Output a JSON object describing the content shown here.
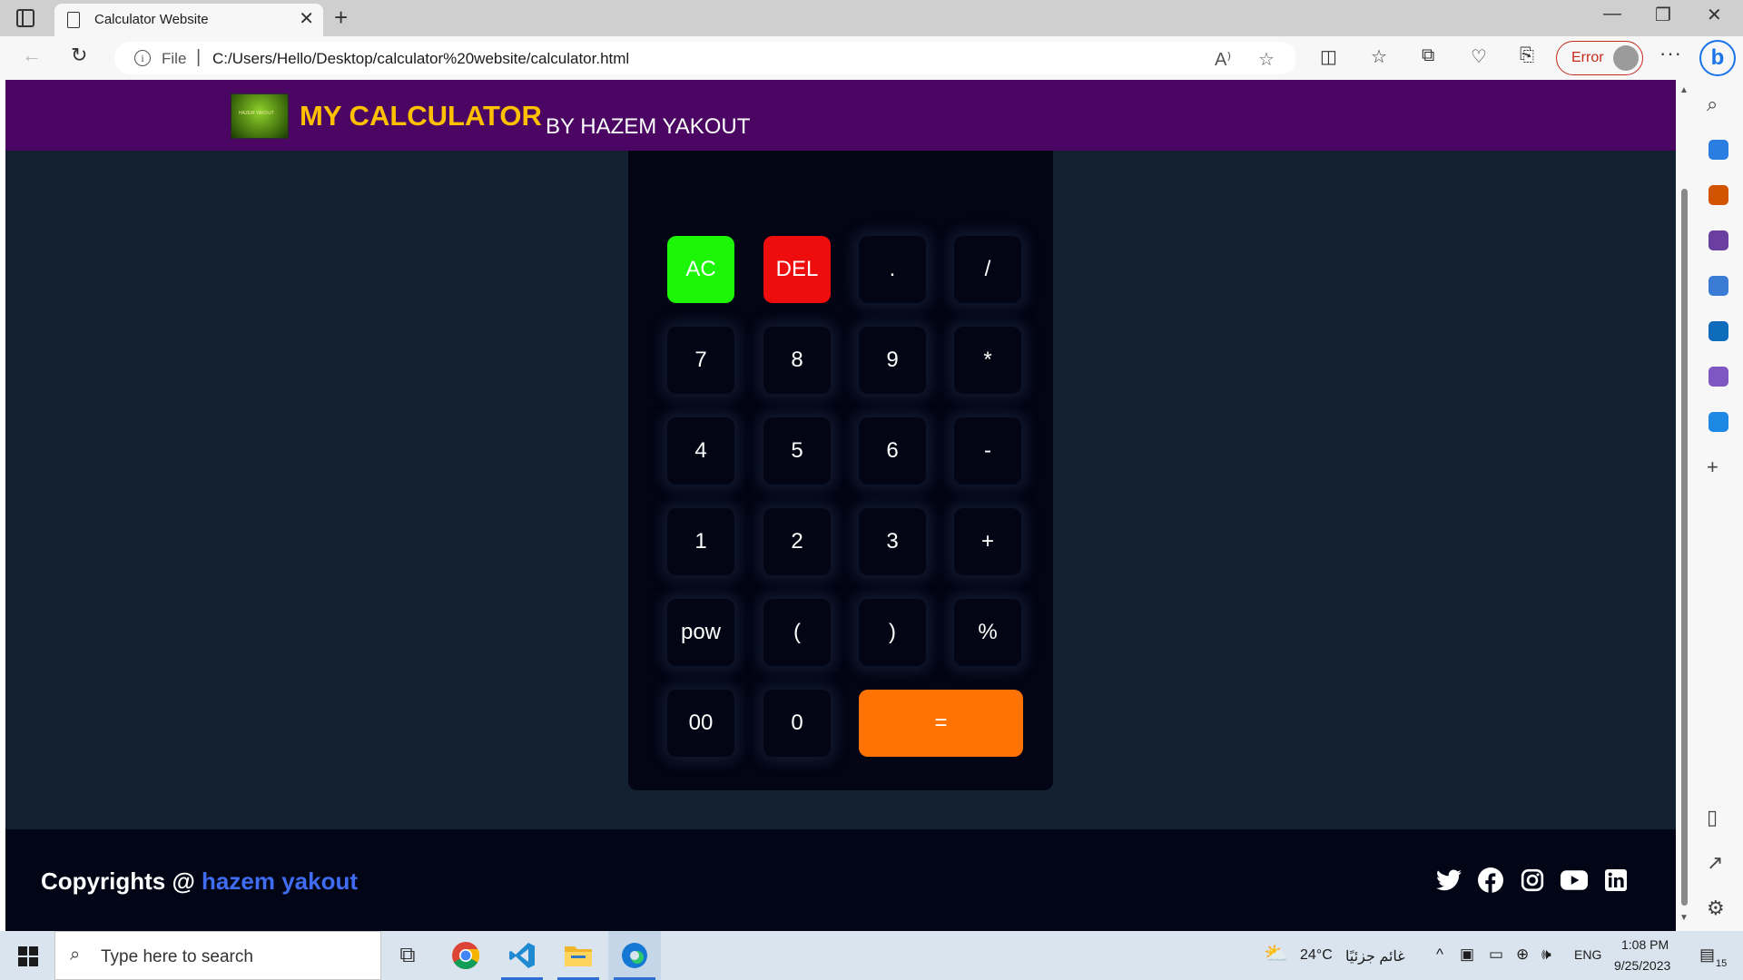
{
  "browser": {
    "tab_title": "Calculator Website",
    "tab_close": "✕",
    "new_tab": "+",
    "window": {
      "minimize": "—",
      "maximize": "❐",
      "close": "✕"
    },
    "nav": {
      "back": "←",
      "refresh": "↻"
    },
    "address": {
      "info": "i",
      "scheme_label": "File",
      "separator": "|",
      "url": "C:/Users/Hello/Desktop/calculator%20website/calculator.html",
      "read_aloud": "A⁾",
      "favorite": "☆"
    },
    "toolbar_icons": {
      "split": "◫",
      "favorites": "☆",
      "collections": "⧉",
      "health": "♡",
      "screenshot": "⎘"
    },
    "profile": {
      "label": "Error",
      "color": "#c42b1c"
    },
    "more": "···",
    "bing": "b"
  },
  "sidebar": {
    "search": "⌕",
    "add": "+",
    "panel": "▯",
    "external": "↗",
    "settings": "⚙",
    "app_colors": [
      "#2a7de1",
      "#d35400",
      "#6b3fa0",
      "#3a7bd5",
      "#0f6cbd",
      "#7e57c2",
      "#1e88e5"
    ]
  },
  "site": {
    "header": {
      "logo_text": "HAZEM YAKOUT",
      "title": "MY CALCULATOR",
      "by": "BY HAZEM YAKOUT",
      "bg": "#4b0562",
      "title_color": "#ffc000"
    },
    "calculator": {
      "keys": [
        "AC",
        "DEL",
        ".",
        "/",
        "7",
        "8",
        "9",
        "*",
        "4",
        "5",
        "6",
        "-",
        "1",
        "2",
        "3",
        "+",
        "pow",
        "(",
        ")",
        "%",
        "00",
        "0",
        "="
      ],
      "colors": {
        "ac": "#1df507",
        "del": "#ee0d0d",
        "equals": "#ff7305",
        "key": "#030514"
      }
    },
    "footer": {
      "copyright_prefix": "Copyrights @",
      "author": "hazem yakout",
      "author_color": "#3f6cf0",
      "social": [
        "twitter-icon",
        "facebook-icon",
        "instagram-icon",
        "youtube-icon",
        "linkedin-icon"
      ]
    }
  },
  "taskbar": {
    "search_placeholder": "Type here to search",
    "search_icon": "⌕",
    "task_view": "⧉",
    "weather": {
      "icon": "⛅",
      "temp": "24°C",
      "text": "غائم جزئيًا"
    },
    "tray": {
      "chevron": "^",
      "network": "⊕",
      "volume": "🕪",
      "lang": "ENG"
    },
    "time": "1:08 PM",
    "date": "9/25/2023",
    "notifications": "15"
  }
}
